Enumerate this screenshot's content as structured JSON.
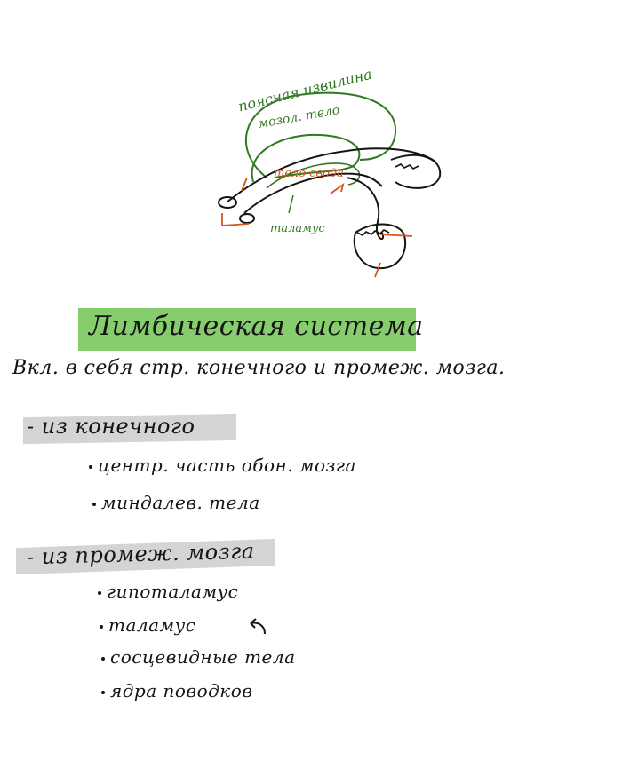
{
  "diagram": {
    "labels": {
      "gyrus": "поясная извилина",
      "corpus_callosum": "мозол. тело",
      "fornix": "тело свода",
      "thalamus": "таламус"
    },
    "colors": {
      "ink": "#141414",
      "green": "#2f7a1f",
      "orange": "#d9531e"
    }
  },
  "page": {
    "title": "Лимбическая система",
    "intro": "Вкл. в себя стр. конечного и промеж. мозга.",
    "sections": [
      {
        "heading": "- из конечного",
        "items": [
          "центр. часть обон. мозга",
          "миндалев. тела"
        ]
      },
      {
        "heading": "- из промеж. мозга",
        "items": [
          "гипоталамус",
          "таламус",
          "сосцевидные тела",
          "ядра поводков"
        ]
      }
    ],
    "highlight_colors": {
      "title": "#86cd6e",
      "section": "#d4d4d4"
    }
  }
}
